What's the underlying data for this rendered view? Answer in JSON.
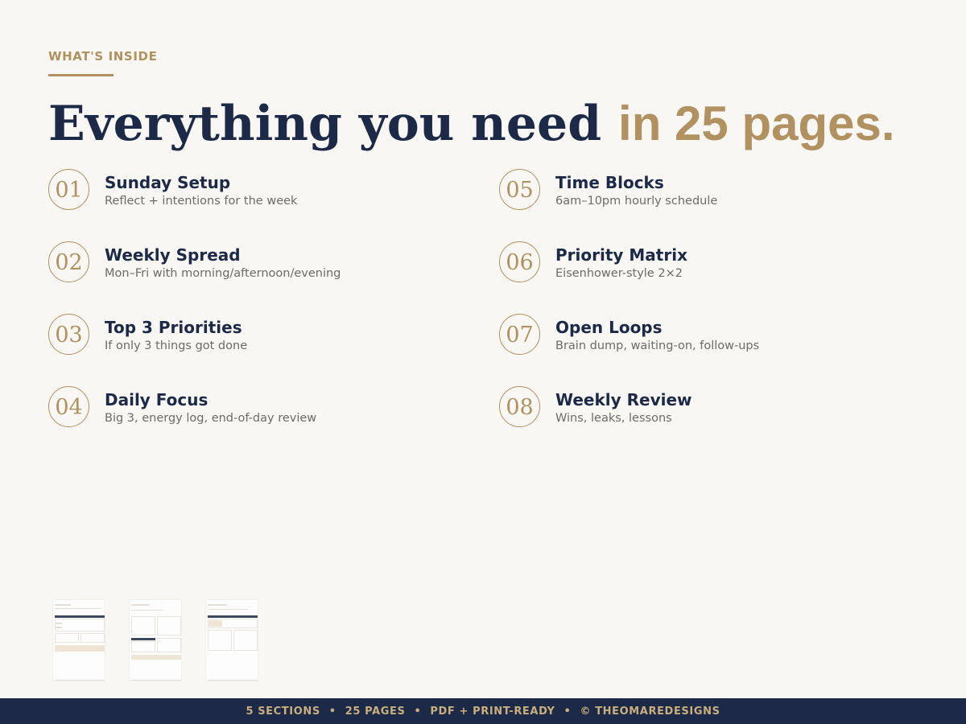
{
  "eyebrow": "WHAT'S INSIDE",
  "headline": {
    "part1": "Everything you need ",
    "part2": "in 25 pages."
  },
  "features": [
    {
      "num": "01",
      "title": "Sunday Setup",
      "desc": "Reflect + intentions for the week"
    },
    {
      "num": "02",
      "title": "Weekly Spread",
      "desc": "Mon–Fri with morning/afternoon/evening"
    },
    {
      "num": "03",
      "title": "Top 3 Priorities",
      "desc": "If only 3 things got done"
    },
    {
      "num": "04",
      "title": "Daily Focus",
      "desc": "Big 3, energy log, end-of-day review"
    },
    {
      "num": "05",
      "title": "Time Blocks",
      "desc": "6am–10pm hourly schedule"
    },
    {
      "num": "06",
      "title": "Priority Matrix",
      "desc": "Eisenhower-style 2×2"
    },
    {
      "num": "07",
      "title": "Open Loops",
      "desc": "Brain dump, waiting-on, follow-ups"
    },
    {
      "num": "08",
      "title": "Weekly Review",
      "desc": "Wins, leaks, lessons"
    }
  ],
  "footer": {
    "items": [
      "5 SECTIONS",
      "25 PAGES",
      "PDF + PRINT-READY",
      "© THEOMAREDESIGNS"
    ],
    "separator": "•"
  },
  "colors": {
    "navy": "#1c2a47",
    "gold": "#b0915f",
    "background": "#f8f7f4",
    "muted_text": "#6d6b67"
  }
}
